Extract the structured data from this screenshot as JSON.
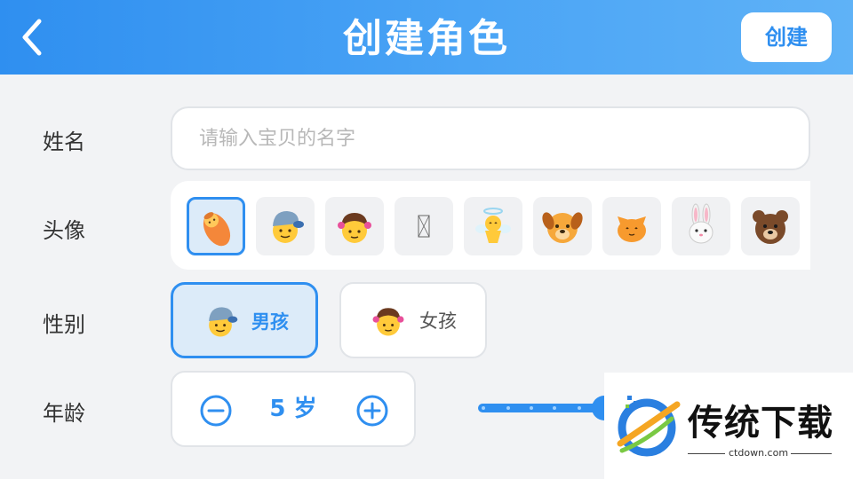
{
  "header": {
    "title": "创建角色",
    "back_icon": "chevron-left-icon",
    "create_label": "创建"
  },
  "name_row": {
    "label": "姓名",
    "value": "",
    "placeholder": "请输入宝贝的名字"
  },
  "avatar_row": {
    "label": "头像",
    "avatars": [
      {
        "icon": "baby-icon",
        "selected": true
      },
      {
        "icon": "boy-icon",
        "selected": false
      },
      {
        "icon": "girl-icon",
        "selected": false
      },
      {
        "icon": "missing-glyph-icon",
        "selected": false
      },
      {
        "icon": "angel-icon",
        "selected": false
      },
      {
        "icon": "dog-icon",
        "selected": false
      },
      {
        "icon": "cat-icon",
        "selected": false
      },
      {
        "icon": "rabbit-icon",
        "selected": false
      },
      {
        "icon": "bear-icon",
        "selected": false
      }
    ]
  },
  "gender_row": {
    "label": "性别",
    "options": [
      {
        "label": "男孩",
        "icon": "boy-icon",
        "selected": true
      },
      {
        "label": "女孩",
        "icon": "girl-icon",
        "selected": false
      }
    ]
  },
  "age_row": {
    "label": "年龄",
    "value": "5 岁",
    "minus_icon": "minus-circle-icon",
    "plus_icon": "plus-circle-icon"
  },
  "watermark": {
    "brand": "传统下载",
    "url": "ctdown.com"
  },
  "colors": {
    "accent": "#2f8ff0",
    "header_start": "#2f8ff0",
    "header_end": "#5fb2f7",
    "background": "#f2f3f5",
    "selected_bg": "#dcebf9"
  }
}
